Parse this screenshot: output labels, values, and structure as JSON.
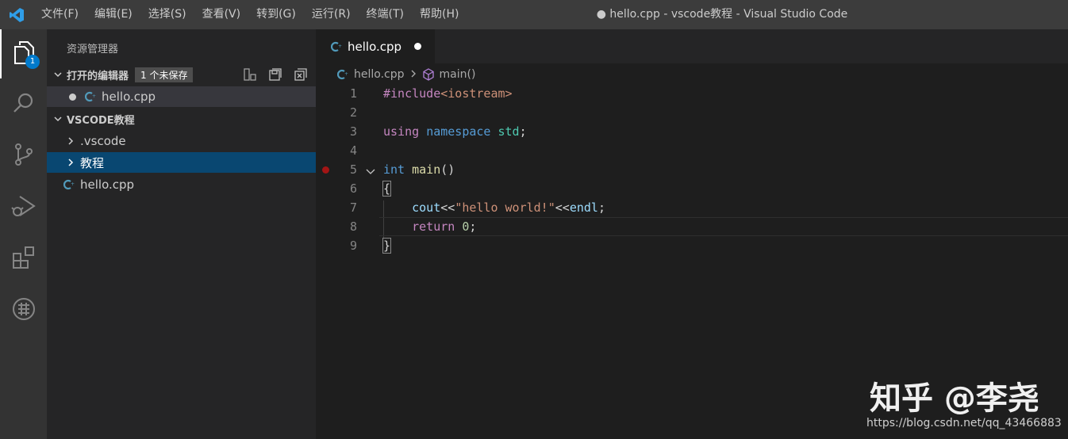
{
  "titlebar": {
    "menu": [
      "文件(F)",
      "编辑(E)",
      "选择(S)",
      "查看(V)",
      "转到(G)",
      "运行(R)",
      "终端(T)",
      "帮助(H)"
    ],
    "window_title": "● hello.cpp - vscode教程 - Visual Studio Code"
  },
  "activitybar": {
    "items": [
      {
        "icon": "files-icon",
        "active": true,
        "badge": "1"
      },
      {
        "icon": "search-icon"
      },
      {
        "icon": "source-control-icon"
      },
      {
        "icon": "run-debug-icon"
      },
      {
        "icon": "extensions-icon"
      },
      {
        "icon": "extension-custom-icon"
      }
    ]
  },
  "sidebar": {
    "title": "资源管理器",
    "open_editors": {
      "label": "打开的编辑器",
      "badge": "1 个未保存",
      "files": [
        {
          "name": "hello.cpp",
          "dirty": true
        }
      ]
    },
    "workspace": {
      "label": "VSCODE教程",
      "items": [
        {
          "name": ".vscode",
          "type": "folder"
        },
        {
          "name": "教程",
          "type": "folder",
          "selected": true
        },
        {
          "name": "hello.cpp",
          "type": "file"
        }
      ]
    }
  },
  "editor": {
    "tab": {
      "label": "hello.cpp",
      "dirty": true
    },
    "breadcrumb": {
      "file": "hello.cpp",
      "symbol": "main()"
    },
    "lines": [
      {
        "n": "1",
        "tokens": [
          {
            "t": "#include",
            "c": "pre"
          },
          {
            "t": "<iostream>",
            "c": "str"
          }
        ]
      },
      {
        "n": "2",
        "tokens": []
      },
      {
        "n": "3",
        "tokens": [
          {
            "t": "using",
            "c": "ctrl"
          },
          {
            "t": " ",
            "c": "plain"
          },
          {
            "t": "namespace",
            "c": "kw"
          },
          {
            "t": " ",
            "c": "plain"
          },
          {
            "t": "std",
            "c": "type"
          },
          {
            "t": ";",
            "c": "plain"
          }
        ]
      },
      {
        "n": "4",
        "tokens": []
      },
      {
        "n": "5",
        "tokens": [
          {
            "t": "int",
            "c": "kw"
          },
          {
            "t": " ",
            "c": "plain"
          },
          {
            "t": "main",
            "c": "fn"
          },
          {
            "t": "()",
            "c": "plain"
          }
        ],
        "breakpoint": true,
        "fold": true
      },
      {
        "n": "6",
        "tokens": [
          {
            "t": "{",
            "c": "brace"
          }
        ]
      },
      {
        "n": "7",
        "tokens": [
          {
            "t": "    ",
            "c": "plain"
          },
          {
            "t": "cout",
            "c": "var"
          },
          {
            "t": "<<",
            "c": "plain"
          },
          {
            "t": "\"hello world!\"",
            "c": "str"
          },
          {
            "t": "<<",
            "c": "plain"
          },
          {
            "t": "endl",
            "c": "var"
          },
          {
            "t": ";",
            "c": "plain"
          }
        ]
      },
      {
        "n": "8",
        "tokens": [
          {
            "t": "    ",
            "c": "plain"
          },
          {
            "t": "return",
            "c": "ctrl"
          },
          {
            "t": " ",
            "c": "plain"
          },
          {
            "t": "0",
            "c": "num"
          },
          {
            "t": ";",
            "c": "plain"
          }
        ],
        "current": true
      },
      {
        "n": "9",
        "tokens": [
          {
            "t": "}",
            "c": "brace"
          }
        ]
      }
    ]
  },
  "watermark": {
    "text": "知乎 @李尧",
    "url": "https://blog.csdn.net/qq_43466883"
  }
}
